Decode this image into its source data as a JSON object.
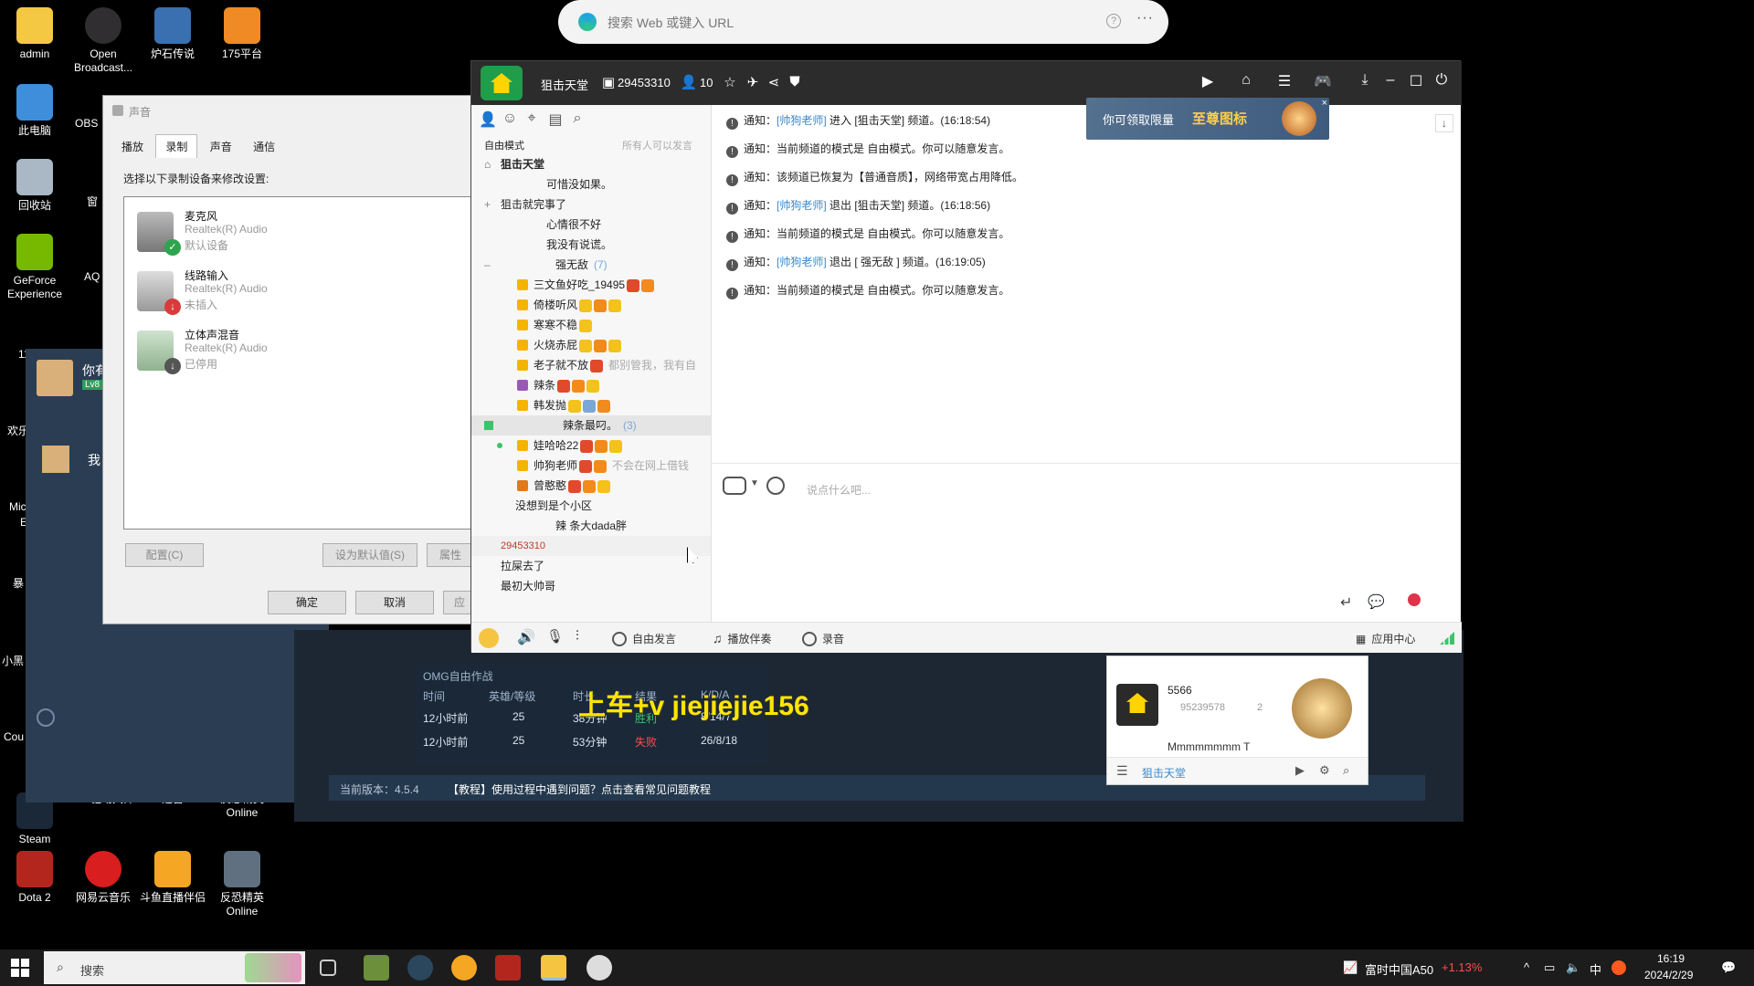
{
  "desktop": {
    "icons_left": [
      {
        "label": "admin"
      },
      {
        "label": "此电脑"
      },
      {
        "label": "回收站"
      },
      {
        "label": "GeForce Experience"
      },
      {
        "label": "Steam"
      },
      {
        "label": "Dota 2"
      }
    ],
    "icons_top": [
      {
        "label": "Open Broadcast..."
      },
      {
        "label": "炉石传说"
      },
      {
        "label": "175平台"
      }
    ],
    "icons_bottom": [
      {
        "label": "360驱动大师"
      },
      {
        "label": "迅雷"
      },
      {
        "label": "反恐精英 Online"
      },
      {
        "label": "网易云音乐"
      },
      {
        "label": "斗鱼直播伴侣"
      },
      {
        "label": "反恐精英 Online"
      }
    ],
    "partial_labels": [
      "OBS",
      "窗",
      "AQ",
      "欢乐",
      "Mic",
      "E",
      "暴",
      "小黑",
      "Cou",
      "11"
    ]
  },
  "browser_bar": {
    "placeholder": "搜索 Web 或键入 URL",
    "help": "?",
    "more": "···"
  },
  "sound_dialog": {
    "title": "声音",
    "tabs": [
      "播放",
      "录制",
      "声音",
      "通信"
    ],
    "instruction": "选择以下录制设备来修改设置:",
    "devices": [
      {
        "name": "麦克风",
        "driver": "Realtek(R) Audio",
        "status": "默认设备"
      },
      {
        "name": "线路输入",
        "driver": "Realtek(R) Audio",
        "status": "未插入"
      },
      {
        "name": "立体声混音",
        "driver": "Realtek(R) Audio",
        "status": "已停用"
      }
    ],
    "configure": "配置(C)",
    "set_default": "设为默认值(S)",
    "properties": "属性",
    "ok": "确定",
    "cancel": "取消",
    "apply": "应"
  },
  "yy": {
    "channel_name": "狙击天堂",
    "channel_id": "29453310",
    "online_count": "10",
    "mode": "自由模式",
    "mode_note": "所有人可以发言",
    "tree": [
      {
        "text": "狙击天堂",
        "indent": 0
      },
      {
        "text": "可惜没如果。",
        "indent": 2
      },
      {
        "text": "狙击就完事了",
        "indent": 0
      },
      {
        "text": "心情很不好",
        "indent": 2
      },
      {
        "text": "我没有说谎。",
        "indent": 2
      },
      {
        "text": "强无敌",
        "count": "(7)",
        "indent": 3
      },
      {
        "text": "三文鱼好吃_19495",
        "indent": 4
      },
      {
        "text": "倚楼听风",
        "indent": 4
      },
      {
        "text": "寒寒不稳",
        "indent": 4
      },
      {
        "text": "火烧赤屁",
        "indent": 4
      },
      {
        "text": "老子就不放",
        "desc": "都别管我，我有自",
        "indent": 4
      },
      {
        "text": "辣条",
        "indent": 4
      },
      {
        "text": "韩发抛",
        "indent": 4
      },
      {
        "text": "辣条最叼。",
        "count": "(3)",
        "indent": 3
      },
      {
        "text": "娃哈哈22",
        "indent": 4
      },
      {
        "text": "帅狗老师",
        "desc": "不会在网上借钱",
        "indent": 4
      },
      {
        "text": "曾憨憨",
        "indent": 4
      },
      {
        "text": "没想到是个小区",
        "indent": 1
      },
      {
        "text": "辣 条大dada胖",
        "indent": 3
      },
      {
        "text": "29453310",
        "indent": 0
      },
      {
        "text": "拉屎去了",
        "indent": 0
      },
      {
        "text": "最初大帅哥",
        "indent": 0
      }
    ],
    "notices": [
      {
        "pre": "通知：",
        "link": "[帅狗老师]",
        "post": "进入 [狙击天堂] 频道。(16:18:54)"
      },
      {
        "pre": "通知：",
        "link": "",
        "post": "当前频道的模式是 自由模式。你可以随意发言。"
      },
      {
        "pre": "通知：",
        "link": "",
        "post": "该频道已恢复为【普通音质】，网络带宽占用降低。"
      },
      {
        "pre": "通知：",
        "link": "[帅狗老师]",
        "post": "退出 [狙击天堂] 频道。(16:18:56)"
      },
      {
        "pre": "通知：",
        "link": "",
        "post": "当前频道的模式是 自由模式。你可以随意发言。"
      },
      {
        "pre": "通知：",
        "link": "[帅狗老师]",
        "post": "退出 [          强无敌 ] 频道。(16:19:05)"
      },
      {
        "pre": "通知：",
        "link": "",
        "post": "当前频道的模式是 自由模式。你可以随意发言。"
      }
    ],
    "promo": {
      "text": "你可领取限量",
      "highlight": "至尊图标"
    },
    "input_placeholder": "说点什么吧...",
    "bottom": {
      "free_speak": "自由发言",
      "accompany": "播放伴奏",
      "record": "录音",
      "app_center": "应用中心"
    }
  },
  "float_list": {
    "name": "5566",
    "id": "95239578",
    "members": "2",
    "partial": "Mmmmmmmm T",
    "footer": "狙击天堂"
  },
  "game_bg": {
    "list_title": "OMG自由作战",
    "headers": [
      "时间",
      "英雄/等级",
      "时长",
      "结果",
      "K/D/A"
    ],
    "rows": [
      {
        "time": "12小时前",
        "level": "25",
        "duration": "38分钟",
        "result": "胜利",
        "kda": "8/14/7"
      },
      {
        "time": "12小时前",
        "level": "25",
        "duration": "53分钟",
        "result": "失败",
        "kda": "26/8/18"
      }
    ],
    "overlay_text": "上车+v  jiejiejie156",
    "version": "当前版本：4.5.4",
    "tutorial": "【教程】使用过程中遇到问题？点击查看常见问题教程"
  },
  "chat_bg": {
    "line1": "你有",
    "line2": "我",
    "tag": "Lv8"
  },
  "taskbar": {
    "search_placeholder": "搜索",
    "stock_name": "富时中国A50",
    "stock_change": "+1.13%",
    "ime": "中",
    "time": "16:19",
    "date": "2024/2/29"
  },
  "colors": {
    "yy_titlebar": "#2c2c2c",
    "yy_green": "#1f9d4a",
    "link": "#3d88c7",
    "stock_up": "#ff4d4d"
  }
}
